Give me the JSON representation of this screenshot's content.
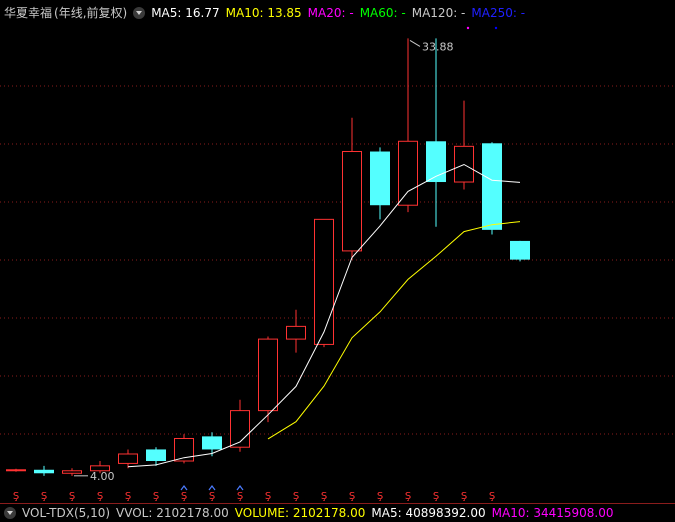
{
  "header": {
    "title": "华夏幸福",
    "mode": "(年线,前复权)",
    "ma5": "MA5: 16.77",
    "ma10": "MA10: 13.85",
    "ma20": "MA20: -",
    "ma60": "MA60: -",
    "ma120": "MA120: -",
    "ma250": "MA250: -"
  },
  "volume_header": {
    "indicator": "VOL-TDX(5,10)",
    "vvol": "VVOL: 2102178.00",
    "volume": "VOLUME: 2102178.00",
    "ma5": "MA5: 40898392.00",
    "ma10": "MA10: 34415908.00"
  },
  "colors": {
    "up": "#ff3232",
    "down": "#54ffff",
    "ma5": "#ffffff",
    "ma10": "#ffff00",
    "ma20": "#ff00ff",
    "ma60": "#00ff00",
    "ma250": "#0000ff",
    "grid": "#8a1c1c",
    "marker": "#ff3232"
  },
  "chart_data": {
    "type": "candlestick",
    "y_scale": "log",
    "ylim": [
      3.9,
      36
    ],
    "grid": "horizontal dotted",
    "max_label": "33.88",
    "min_label": "4.00",
    "candles": [
      {
        "open": 4.1,
        "close": 4.12,
        "high": 4.14,
        "low": 4.08
      },
      {
        "open": 4.12,
        "close": 4.05,
        "high": 4.2,
        "low": 4.0
      },
      {
        "open": 4.05,
        "close": 4.1,
        "high": 4.15,
        "low": 4.0
      },
      {
        "open": 4.1,
        "close": 4.2,
        "high": 4.3,
        "low": 4.05
      },
      {
        "open": 4.25,
        "close": 4.45,
        "high": 4.55,
        "low": 4.15
      },
      {
        "open": 4.55,
        "close": 4.3,
        "high": 4.6,
        "low": 4.2
      },
      {
        "open": 4.3,
        "close": 4.8,
        "high": 4.9,
        "low": 4.25
      },
      {
        "open": 4.85,
        "close": 4.55,
        "high": 4.95,
        "low": 4.4
      },
      {
        "open": 4.6,
        "close": 5.5,
        "high": 5.8,
        "low": 4.5
      },
      {
        "open": 5.5,
        "close": 7.8,
        "high": 7.9,
        "low": 5.2
      },
      {
        "open": 7.8,
        "close": 8.3,
        "high": 9.0,
        "low": 7.3
      },
      {
        "open": 7.6,
        "close": 14.0,
        "high": 14.0,
        "low": 7.5
      },
      {
        "open": 12.0,
        "close": 19.5,
        "high": 23.0,
        "low": 11.5
      },
      {
        "open": 19.5,
        "close": 15.0,
        "high": 19.9,
        "low": 14.0
      },
      {
        "open": 15.0,
        "close": 20.5,
        "high": 33.88,
        "low": 14.5
      },
      {
        "open": 20.5,
        "close": 16.8,
        "high": 33.88,
        "low": 13.5
      },
      {
        "open": 16.8,
        "close": 20.0,
        "high": 25.0,
        "low": 16.2
      },
      {
        "open": 20.3,
        "close": 13.3,
        "high": 20.4,
        "low": 13.0
      },
      {
        "open": 12.6,
        "close": 11.5,
        "high": 12.6,
        "low": 11.4
      }
    ],
    "ma5": [
      null,
      null,
      null,
      null,
      4.18,
      4.22,
      4.37,
      4.46,
      4.72,
      5.39,
      6.19,
      8.08,
      11.62,
      13.56,
      16.05,
      17.28,
      18.3,
      16.95,
      16.77
    ],
    "ma10": [
      null,
      null,
      null,
      null,
      null,
      null,
      null,
      null,
      null,
      4.79,
      5.21,
      6.2,
      7.85,
      8.91,
      10.44,
      11.69,
      13.19,
      13.64,
      13.85
    ],
    "markers": [
      {
        "index": 0,
        "symbol": "Ş"
      },
      {
        "index": 1,
        "symbol": "Ş"
      },
      {
        "index": 2,
        "symbol": "Ş"
      },
      {
        "index": 3,
        "symbol": "Ş"
      },
      {
        "index": 4,
        "symbol": "Ş"
      },
      {
        "index": 5,
        "symbol": "Ş"
      },
      {
        "index": 6,
        "symbol": "Ş"
      },
      {
        "index": 7,
        "symbol": "Ş"
      },
      {
        "index": 8,
        "symbol": "Ş"
      },
      {
        "index": 9,
        "symbol": "Ş"
      },
      {
        "index": 10,
        "symbol": "Ş"
      },
      {
        "index": 11,
        "symbol": "Ş"
      },
      {
        "index": 12,
        "symbol": "Ş"
      },
      {
        "index": 13,
        "symbol": "Ş"
      },
      {
        "index": 14,
        "symbol": "Ş"
      },
      {
        "index": 15,
        "symbol": "Ş"
      },
      {
        "index": 16,
        "symbol": "Ş"
      },
      {
        "index": 17,
        "symbol": "Ş"
      }
    ],
    "arrow_markers": [
      6,
      7,
      8
    ]
  }
}
